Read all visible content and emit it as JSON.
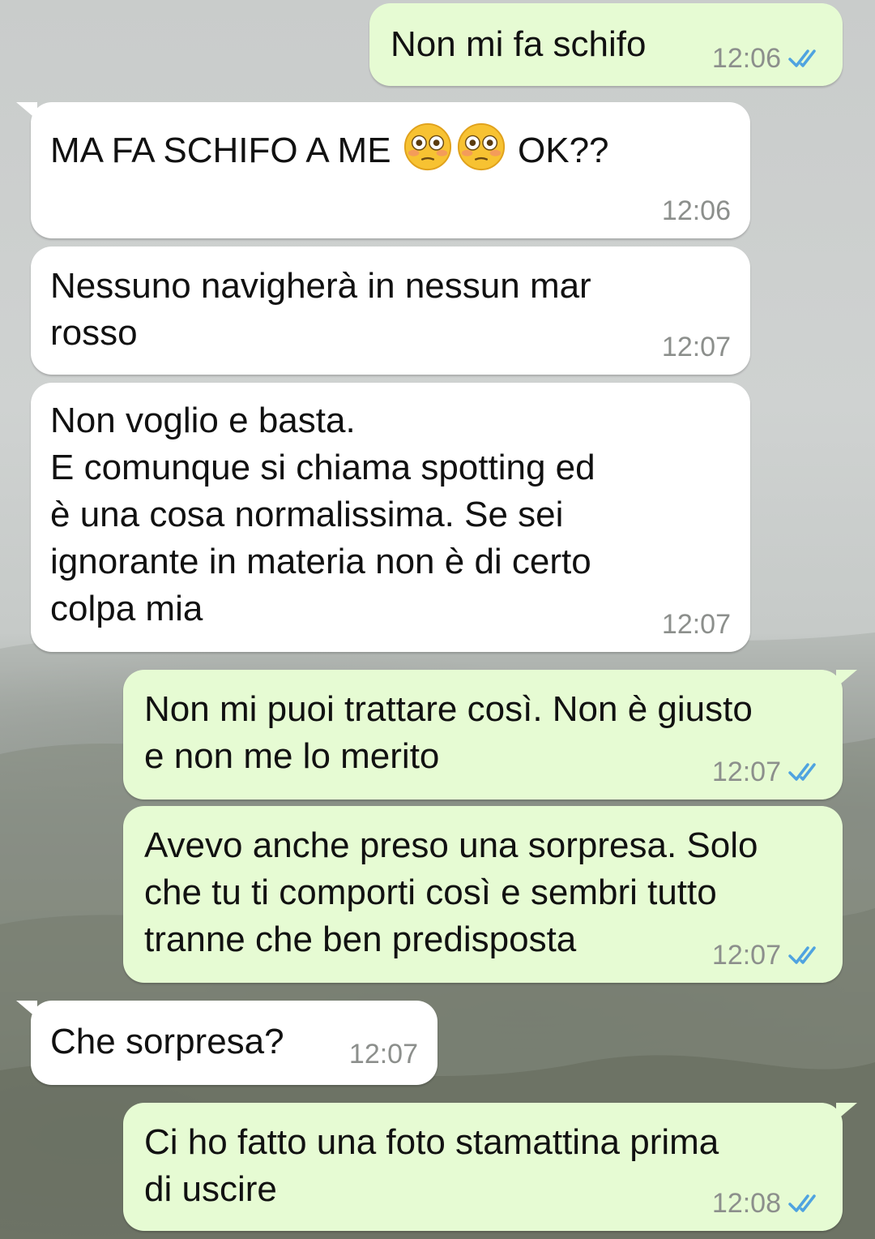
{
  "messages": [
    {
      "direction": "out",
      "text": "Non mi fa schifo",
      "time": "12:06",
      "status": "read"
    },
    {
      "direction": "in",
      "text_before": "MA FA SCHIFO A ME ",
      "emojis": [
        "flushed-face",
        "flushed-face"
      ],
      "text_after": " OK??",
      "time": "12:06"
    },
    {
      "direction": "in",
      "text": "Nessuno navigherà in nessun mar\nrosso",
      "time": "12:07"
    },
    {
      "direction": "in",
      "text": "Non voglio e basta.\nE comunque si chiama spotting ed\nè una cosa normalissima. Se sei\nignorante in materia non è di certo\ncolpa mia",
      "time": "12:07"
    },
    {
      "direction": "out",
      "text": "Non mi puoi trattare così. Non è giusto\ne non me lo merito",
      "time": "12:07",
      "status": "read"
    },
    {
      "direction": "out",
      "text": "Avevo anche preso una sorpresa. Solo\nche tu ti comporti così e sembri tutto\ntranne che ben predisposta",
      "time": "12:07",
      "status": "read"
    },
    {
      "direction": "in",
      "text": "Che sorpresa?",
      "time": "12:07"
    },
    {
      "direction": "out",
      "text": "Ci ho fatto una foto stamattina prima\ndi uscire",
      "time": "12:08",
      "status": "read"
    }
  ],
  "colors": {
    "incoming_bubble": "#ffffff",
    "outgoing_bubble": "#e6fbd3",
    "read_ticks": "#4fa3e0",
    "timestamp": "#8c8f8c"
  },
  "icons": {
    "read_receipt": "double-check-icon",
    "emoji": "flushed-face-emoji"
  }
}
